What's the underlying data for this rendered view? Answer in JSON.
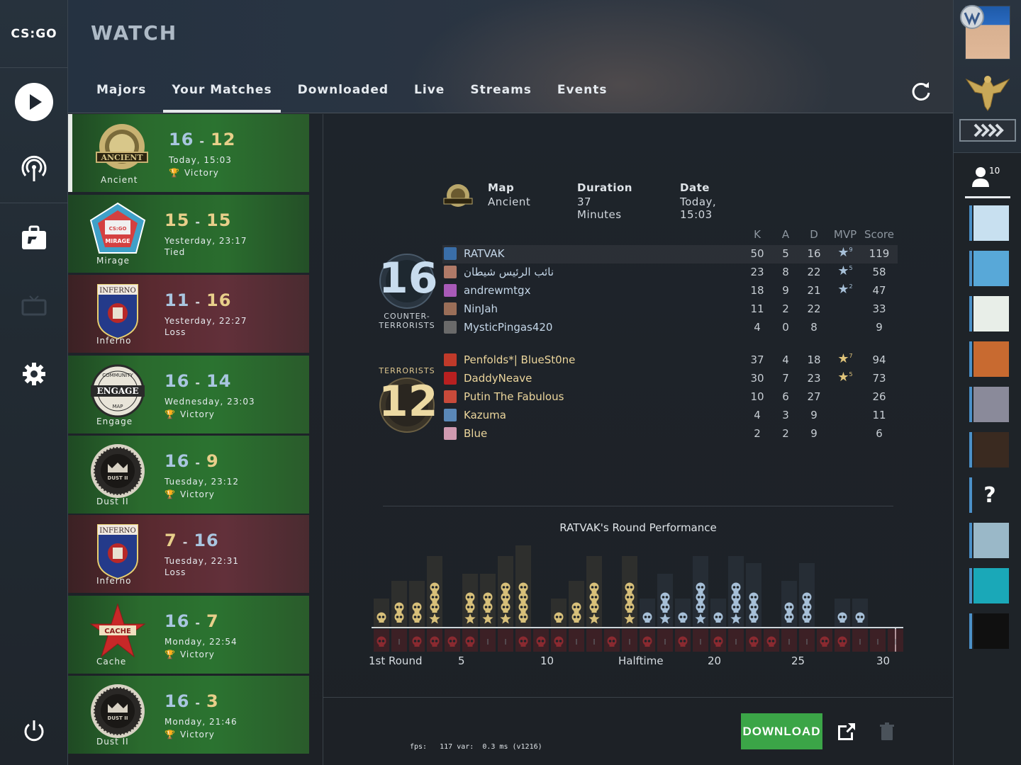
{
  "app": {
    "title": "WATCH"
  },
  "logo": {
    "text": "CS:GO"
  },
  "tabs": [
    {
      "label": "Majors",
      "active": false
    },
    {
      "label": "Your Matches",
      "active": true
    },
    {
      "label": "Downloaded",
      "active": false
    },
    {
      "label": "Live",
      "active": false
    },
    {
      "label": "Streams",
      "active": false
    },
    {
      "label": "Events",
      "active": false
    }
  ],
  "matches": [
    {
      "map": "Ancient",
      "score_a": "16",
      "score_b": "12",
      "when": "Today, 15:03",
      "result": "Victory",
      "outcome": "win",
      "selected": true
    },
    {
      "map": "Mirage",
      "score_a": "15",
      "score_b": "15",
      "when": "Yesterday, 23:17",
      "result": "Tied",
      "outcome": "tie"
    },
    {
      "map": "Inferno",
      "score_a": "11",
      "score_b": "16",
      "when": "Yesterday, 22:27",
      "result": "Loss",
      "outcome": "loss"
    },
    {
      "map": "Engage",
      "score_a": "16",
      "score_b": "14",
      "when": "Wednesday, 23:03",
      "result": "Victory",
      "outcome": "win"
    },
    {
      "map": "Dust II",
      "score_a": "16",
      "score_b": "9",
      "when": "Tuesday, 23:12",
      "result": "Victory",
      "outcome": "win"
    },
    {
      "map": "Inferno",
      "score_a": "7",
      "score_b": "16",
      "when": "Tuesday, 22:31",
      "result": "Loss",
      "outcome": "loss"
    },
    {
      "map": "Cache",
      "score_a": "16",
      "score_b": "7",
      "when": "Monday, 22:54",
      "result": "Victory",
      "outcome": "win"
    },
    {
      "map": "Dust II",
      "score_a": "16",
      "score_b": "3",
      "when": "Monday, 21:46",
      "result": "Victory",
      "outcome": "win"
    }
  ],
  "emblem_text": {
    "ancient": "ANCIENT",
    "mirage": "MIRAGE",
    "mirage_small": "CS:GO",
    "inferno": "INFERNO",
    "engage_top": "COMMUNITY",
    "engage": "ENGAGE",
    "engage_bottom": "MAP",
    "dust": "DUST II",
    "cache": "CACHE"
  },
  "detail": {
    "map_label": "Map",
    "map_value": "Ancient",
    "duration_label": "Duration",
    "duration_value": "37 Minutes",
    "date_label": "Date",
    "date_value": "Today, 15:03"
  },
  "scoreboard": {
    "headers": {
      "k": "K",
      "a": "A",
      "d": "D",
      "mvp": "MVP",
      "score": "Score"
    },
    "ct_score": "16",
    "t_score": "12",
    "ct_label_1": "COUNTER-",
    "ct_label_2": "TERRORISTS",
    "t_label": "TERRORISTS",
    "ct_players": [
      {
        "name": "RATVAK",
        "k": "50",
        "a": "5",
        "d": "16",
        "mvp": "9",
        "score": "119",
        "color": "#3a6ea8"
      },
      {
        "name": "نائب الرئيس شيطان",
        "k": "23",
        "a": "8",
        "d": "22",
        "mvp": "5",
        "score": "58",
        "color": "#b07a68"
      },
      {
        "name": "andrewmtgx",
        "k": "18",
        "a": "9",
        "d": "21",
        "mvp": "2",
        "score": "47",
        "color": "#a85ab8"
      },
      {
        "name": "NinJah",
        "k": "11",
        "a": "2",
        "d": "22",
        "mvp": "",
        "score": "33",
        "color": "#9a6e58"
      },
      {
        "name": "MysticPingas420",
        "k": "4",
        "a": "0",
        "d": "8",
        "mvp": "",
        "score": "9",
        "color": "#6a6a6a"
      }
    ],
    "t_players": [
      {
        "name": "Penfolds*| BlueSt0ne",
        "k": "37",
        "a": "4",
        "d": "18",
        "mvp": "7",
        "score": "94",
        "color": "#c03a2a"
      },
      {
        "name": "DaddyNeave",
        "k": "30",
        "a": "7",
        "d": "23",
        "mvp": "5",
        "score": "73",
        "color": "#b82020"
      },
      {
        "name": "Putin The Fabulous",
        "k": "10",
        "a": "6",
        "d": "27",
        "mvp": "",
        "score": "26",
        "color": "#c84a3a"
      },
      {
        "name": "Kazuma",
        "k": "4",
        "a": "3",
        "d": "9",
        "mvp": "",
        "score": "11",
        "color": "#5a88b8"
      },
      {
        "name": "Blue",
        "k": "2",
        "a": "2",
        "d": "9",
        "mvp": "",
        "score": "6",
        "color": "#d09ab0"
      }
    ]
  },
  "performance": {
    "title": "RATVAK's Round Performance",
    "x_labels": [
      "1st Round",
      "5",
      "10",
      "Halftime",
      "20",
      "25",
      "30"
    ],
    "rounds": [
      {
        "kills": 1,
        "mvp": false,
        "died": true
      },
      {
        "kills": 2,
        "mvp": false,
        "died": false
      },
      {
        "kills": 2,
        "mvp": false,
        "died": true
      },
      {
        "kills": 3,
        "mvp": true,
        "died": true
      },
      {
        "kills": 0,
        "mvp": false,
        "died": true
      },
      {
        "kills": 2,
        "mvp": true,
        "died": true
      },
      {
        "kills": 2,
        "mvp": true,
        "died": false
      },
      {
        "kills": 3,
        "mvp": true,
        "died": false
      },
      {
        "kills": 4,
        "mvp": false,
        "died": true
      },
      {
        "kills": 0,
        "mvp": false,
        "died": true
      },
      {
        "kills": 1,
        "mvp": false,
        "died": true
      },
      {
        "kills": 2,
        "mvp": false,
        "died": false
      },
      {
        "kills": 3,
        "mvp": true,
        "died": false
      },
      {
        "kills": 0,
        "mvp": false,
        "died": true
      },
      {
        "kills": 3,
        "mvp": true,
        "died": false
      },
      {
        "kills": 1,
        "mvp": false,
        "died": true
      },
      {
        "kills": 2,
        "mvp": true,
        "died": false
      },
      {
        "kills": 1,
        "mvp": false,
        "died": true
      },
      {
        "kills": 3,
        "mvp": true,
        "died": false
      },
      {
        "kills": 1,
        "mvp": false,
        "died": true
      },
      {
        "kills": 3,
        "mvp": true,
        "died": false
      },
      {
        "kills": 3,
        "mvp": false,
        "died": true
      },
      {
        "kills": 0,
        "mvp": false,
        "died": true
      },
      {
        "kills": 2,
        "mvp": false,
        "died": false
      },
      {
        "kills": 3,
        "mvp": false,
        "died": false
      },
      {
        "kills": 0,
        "mvp": false,
        "died": true
      },
      {
        "kills": 1,
        "mvp": false,
        "died": true
      },
      {
        "kills": 1,
        "mvp": false,
        "died": false
      },
      {
        "kills": 0,
        "mvp": false,
        "died": false
      },
      {
        "kills": 0,
        "mvp": false,
        "died": false
      }
    ],
    "colors": {
      "ct": "#a7c0d8",
      "t": "#d8c07a",
      "death": "#8a2a30"
    }
  },
  "footer": {
    "download_label": "DOWNLOAD",
    "fps_text": "fps:   117 var:  0.3 ms (v1216)"
  },
  "friends": {
    "count": "10",
    "list": [
      {
        "name": "friend-1",
        "color": "#c8e0f0"
      },
      {
        "name": "friend-2",
        "color": "#58a8d8"
      },
      {
        "name": "friend-3",
        "color": "#e8eee8"
      },
      {
        "name": "friend-4",
        "color": "#c86a30"
      },
      {
        "name": "friend-5",
        "color": "#8a8a9a"
      },
      {
        "name": "friend-6",
        "color": "#3a2a20"
      },
      {
        "name": "friend-7",
        "color": "#1e2328"
      },
      {
        "name": "friend-8",
        "color": "#9ab8c8"
      },
      {
        "name": "friend-9",
        "color": "#1aa8b8"
      },
      {
        "name": "friend-10",
        "color": "#101010"
      }
    ],
    "unknown_glyph": "?"
  }
}
